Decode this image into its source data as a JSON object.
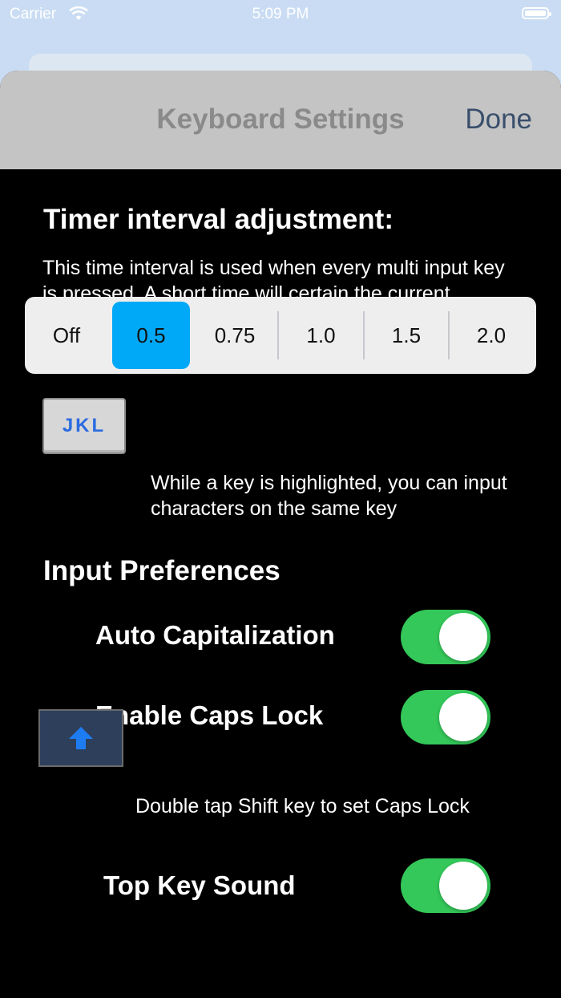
{
  "status_bar": {
    "carrier": "Carrier",
    "time": "5:09 PM"
  },
  "nav": {
    "title": "Keyboard Settings",
    "done_label": "Done"
  },
  "timer": {
    "title": "Timer interval adjustment:",
    "description": "This time interval is used when every multi input key is pressed. A short time will certain the current character sooner.",
    "options": [
      "Off",
      "0.5",
      "0.75",
      "1.0",
      "1.5",
      "2.0"
    ],
    "selected": "0.5"
  },
  "jkl_key": {
    "label": "JKL",
    "hint": "While a key is highlighted, you can input characters on the same key"
  },
  "input_preferences": {
    "title": "Input Preferences",
    "auto_capitalization": {
      "label": "Auto Capitalization",
      "on": true
    },
    "caps_lock": {
      "label": "Enable Caps Lock",
      "on": true
    },
    "shift_hint": "Double tap Shift key to set Caps Lock",
    "top_key_sound": {
      "label": "Top Key Sound",
      "on": true
    }
  },
  "colors": {
    "accent_selected": "#00a9f7",
    "switch_on": "#34c759",
    "key_text": "#2b6be0",
    "shift_arrow": "#1e7cf2"
  }
}
